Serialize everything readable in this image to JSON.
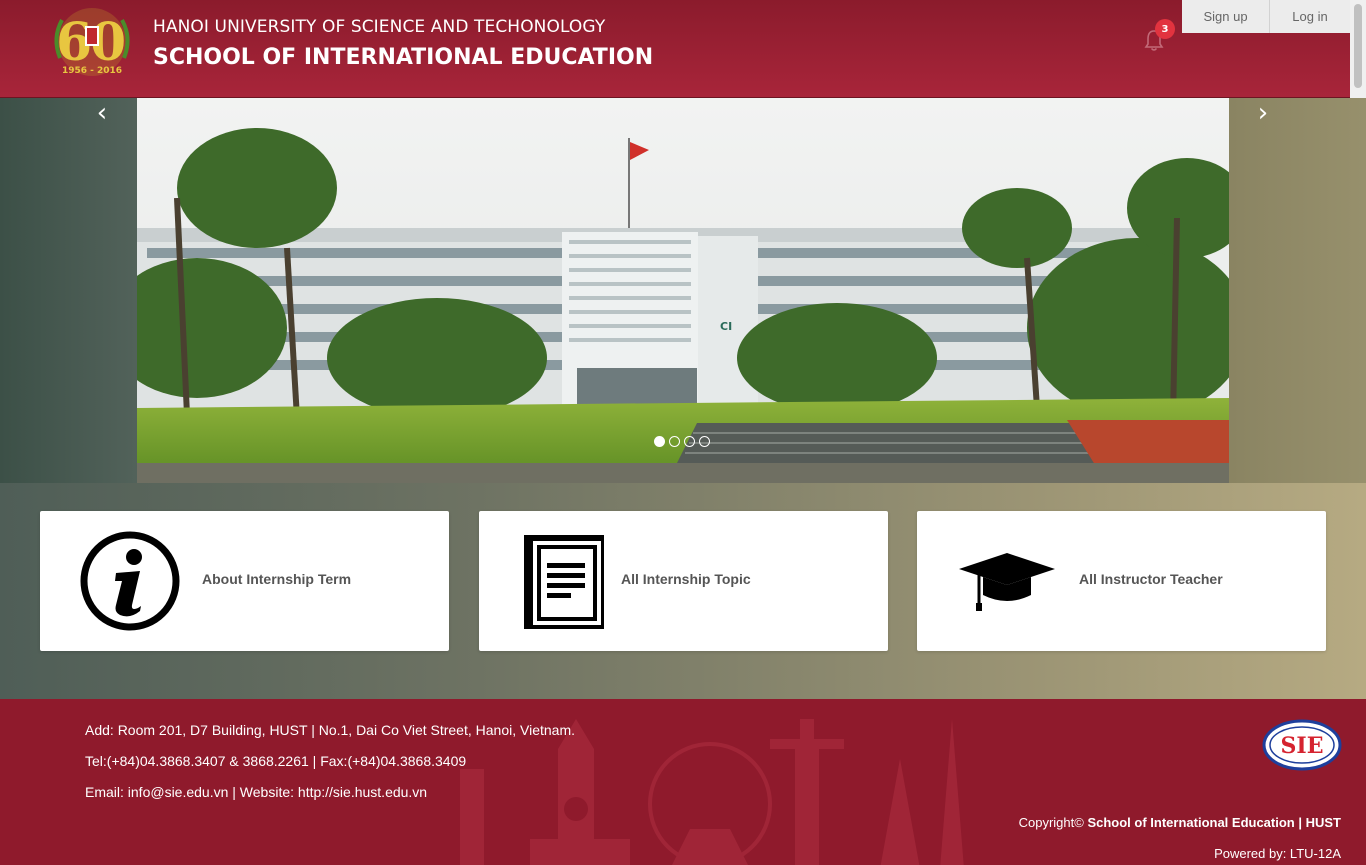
{
  "header": {
    "logo_text": "60",
    "logo_years": "1956 - 2016",
    "university_name": "HANOI UNIVERSITY OF SCIENCE AND TECHONOLOGY",
    "school_name": "SCHOOL OF INTERNATIONAL EDUCATION",
    "notification_count": "3",
    "signup_label": "Sign up",
    "login_label": "Log in"
  },
  "carousel": {
    "prev_icon": "chevron-left-icon",
    "next_icon": "chevron-right-icon",
    "slide_count": 4,
    "active_slide": 1
  },
  "cards": [
    {
      "label": "About Internship Term",
      "icon": "info-icon"
    },
    {
      "label": "All Internship Topic",
      "icon": "book-icon"
    },
    {
      "label": "All Instructor Teacher",
      "icon": "graduation-cap-icon"
    }
  ],
  "footer": {
    "address": "Add: Room 201, D7 Building, HUST | No.1, Dai Co Viet Street, Hanoi, Vietnam.",
    "phone": "Tel:(+84)04.3868.3407 & 3868.2261 | Fax:(+84)04.3868.3409",
    "contact": "Email: info@sie.edu.vn | Website: http://sie.hust.edu.vn",
    "copyright_prefix": "Copyright©",
    "copyright_org": "School of International Education | HUST",
    "powered_by": "Powered by: LTU-12A",
    "logo_text": "SIE"
  },
  "colors": {
    "brand": "#8f1a2c",
    "badge": "#e2333f",
    "logo_gold": "#e8c640"
  }
}
